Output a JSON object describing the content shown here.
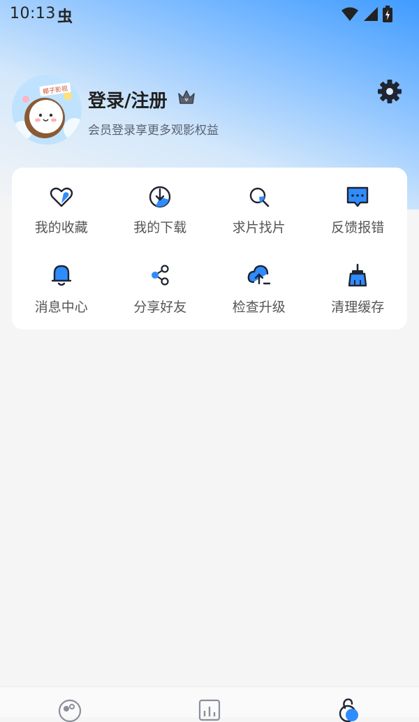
{
  "status_bar": {
    "time": "10:13",
    "app_indicator": "虫",
    "icons": [
      "wifi-icon",
      "signal-icon",
      "battery-icon"
    ]
  },
  "profile": {
    "title": "登录/注册",
    "subtitle": "会员登录享更多观影权益",
    "avatar_badge": "椰子影视",
    "icons": [
      "crown-icon",
      "settings-icon"
    ]
  },
  "menu": {
    "items": [
      {
        "label": "我的收藏",
        "icon": "heart-icon"
      },
      {
        "label": "我的下载",
        "icon": "download-icon"
      },
      {
        "label": "求片找片",
        "icon": "search-icon"
      },
      {
        "label": "反馈报错",
        "icon": "feedback-icon"
      },
      {
        "label": "消息中心",
        "icon": "bell-icon"
      },
      {
        "label": "分享好友",
        "icon": "share-icon"
      },
      {
        "label": "检查升级",
        "icon": "cloud-upload-icon"
      },
      {
        "label": "清理缓存",
        "icon": "broom-icon"
      }
    ]
  },
  "bottom_nav": {
    "tabs": [
      "home-tab",
      "ranking-tab",
      "profile-tab"
    ],
    "active": "profile-tab"
  },
  "colors": {
    "accent": "#2f8cff",
    "dark": "#1f2430",
    "background": "#f5f5f5"
  }
}
